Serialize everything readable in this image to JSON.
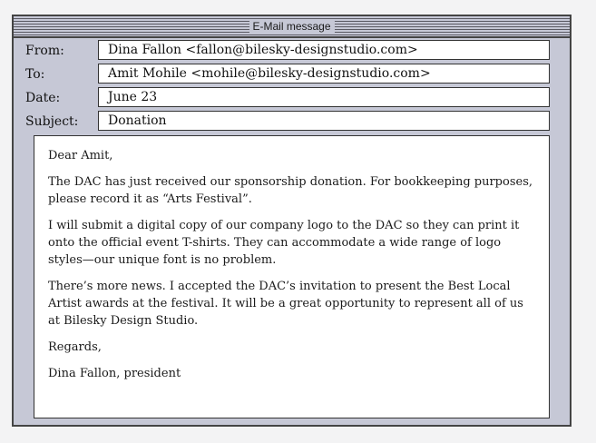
{
  "window": {
    "title": "E-Mail message"
  },
  "headers": {
    "from": {
      "label": "From:",
      "value": "Dina Fallon <fallon@bilesky-designstudio.com>"
    },
    "to": {
      "label": "To:",
      "value": "Amit Mohile <mohile@bilesky-designstudio.com>"
    },
    "date": {
      "label": "Date:",
      "value": "June 23"
    },
    "subject": {
      "label": "Subject:",
      "value": "Donation"
    }
  },
  "body": {
    "greeting": "Dear Amit,",
    "paragraphs": [
      "The DAC has just received our sponsorship donation. For bookkeeping purposes, please record it as “Arts Festival”.",
      "I will submit a digital copy of our company logo to the DAC so they can print it onto the official event T-shirts. They can accommodate a wide range of logo styles—our unique font is no problem.",
      "There’s more news. I accepted the DAC’s invitation to present the Best Local Artist awards at the festival. It will be a great opportunity to represent all of us at Bilesky Design Studio."
    ],
    "closing": "Regards,",
    "signature": "Dina Fallon, president"
  }
}
